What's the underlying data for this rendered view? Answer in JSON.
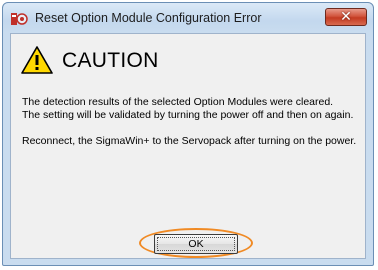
{
  "dialog": {
    "title": "Reset Option Module Configuration Error",
    "close_label": "✕",
    "title_icon": "servo-app-icon"
  },
  "caution": {
    "icon": "warning-triangle-icon",
    "heading": "CAUTION"
  },
  "message": {
    "line1": "The detection results of the selected Option Modules were cleared.",
    "line2": "The setting will be validated by turning the power off and then on again.",
    "line3": "Reconnect, the SigmaWin+ to the Servopack after turning on the power."
  },
  "buttons": {
    "ok_label": "OK"
  },
  "colors": {
    "highlight": "#f08a24",
    "warning_yellow": "#ffd800",
    "close_red": "#c43b22"
  }
}
